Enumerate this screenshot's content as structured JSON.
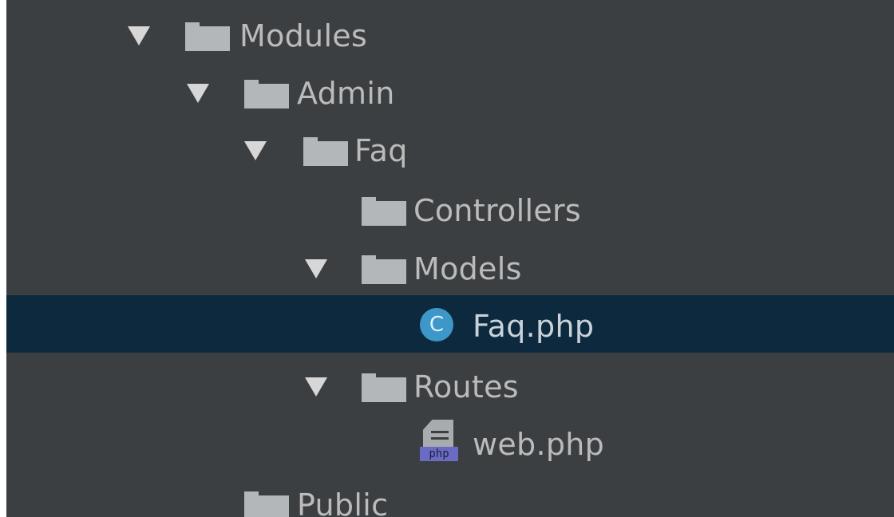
{
  "tree": {
    "nodes": [
      {
        "label": "Modules",
        "expanded": true,
        "icon": "folder-icon"
      },
      {
        "label": "Admin",
        "expanded": true,
        "icon": "folder-icon"
      },
      {
        "label": "Faq",
        "expanded": true,
        "icon": "folder-icon"
      },
      {
        "label": "Controllers",
        "expanded": false,
        "icon": "folder-icon"
      },
      {
        "label": "Models",
        "expanded": true,
        "icon": "folder-icon"
      },
      {
        "label": "Faq.php",
        "selected": true,
        "icon": "php-class-icon",
        "icon_text": "C"
      },
      {
        "label": "Routes",
        "expanded": true,
        "icon": "folder-icon"
      },
      {
        "label": "web.php",
        "icon": "php-file-icon",
        "icon_text": "php"
      },
      {
        "label": "Public",
        "icon": "folder-icon"
      }
    ]
  },
  "colors": {
    "background": "#3c3f41",
    "selection": "#0d293e",
    "text": "#bbbbbb",
    "folder": "#b4b7ba",
    "class_icon": "#3d97c9",
    "php_badge": "#6a6cc4"
  }
}
